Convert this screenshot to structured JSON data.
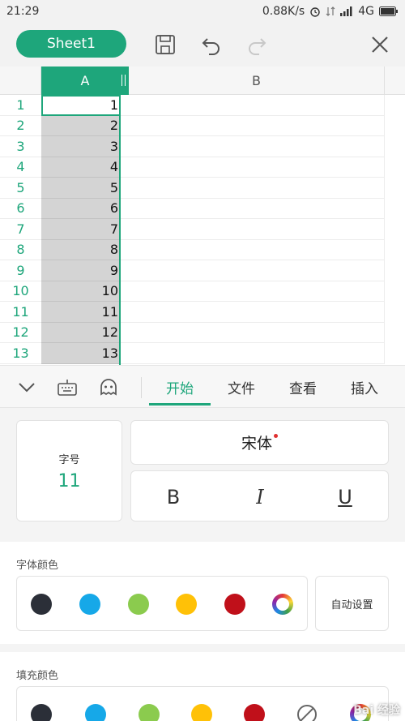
{
  "status_bar": {
    "time": "21:29",
    "speed": "0.88K/s",
    "network": "4G"
  },
  "toolbar": {
    "sheet_name": "Sheet1"
  },
  "grid": {
    "columns": [
      "A",
      "B"
    ],
    "rows": [
      {
        "num": "1",
        "a": "1"
      },
      {
        "num": "2",
        "a": "2"
      },
      {
        "num": "3",
        "a": "3"
      },
      {
        "num": "4",
        "a": "4"
      },
      {
        "num": "5",
        "a": "5"
      },
      {
        "num": "6",
        "a": "6"
      },
      {
        "num": "7",
        "a": "7"
      },
      {
        "num": "8",
        "a": "8"
      },
      {
        "num": "9",
        "a": "9"
      },
      {
        "num": "10",
        "a": "10"
      },
      {
        "num": "11",
        "a": "11"
      },
      {
        "num": "12",
        "a": "12"
      },
      {
        "num": "13",
        "a": "13"
      }
    ]
  },
  "tabs": [
    {
      "label": "开始",
      "active": true
    },
    {
      "label": "文件",
      "active": false
    },
    {
      "label": "查看",
      "active": false
    },
    {
      "label": "插入",
      "active": false
    }
  ],
  "font_panel": {
    "size_label": "字号",
    "size_value": "11",
    "font_name": "宋体",
    "bold": "B",
    "italic": "I",
    "underline": "U"
  },
  "font_color": {
    "label": "字体颜色",
    "auto_label": "自动设置",
    "swatches": [
      "#2b2f38",
      "#16a8e8",
      "#8bcb4e",
      "#ffc107",
      "#c0101a"
    ]
  },
  "fill_color": {
    "label": "填充颜色",
    "swatches": [
      "#2b2f38",
      "#16a8e8",
      "#8bcb4e",
      "#ffc107",
      "#c0101a"
    ]
  },
  "colors": {
    "accent": "#1ea67b"
  },
  "watermark": "Bai 经验"
}
